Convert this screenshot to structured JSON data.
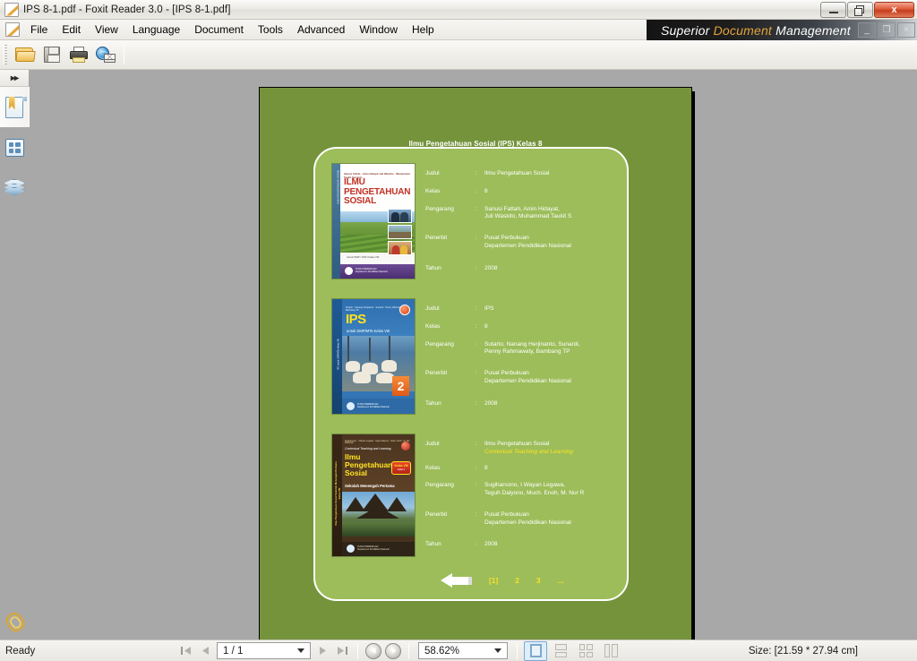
{
  "window": {
    "title": "IPS 8-1.pdf - Foxit Reader 3.0 - [IPS 8-1.pdf]",
    "title_icon": "pdf-document-icon",
    "minimize_label": "",
    "maximize_label": "",
    "close_label": "x"
  },
  "menu": {
    "icon": "pdf-document-icon",
    "items": [
      {
        "label": "File"
      },
      {
        "label": "Edit"
      },
      {
        "label": "View"
      },
      {
        "label": "Language"
      },
      {
        "label": "Document"
      },
      {
        "label": "Tools"
      },
      {
        "label": "Advanced"
      },
      {
        "label": "Window"
      },
      {
        "label": "Help"
      }
    ],
    "banner": {
      "word1": "Superior ",
      "word2": "Document ",
      "word3": "Management",
      "min_label": "_",
      "restore_label": "❐",
      "close_label": "×"
    }
  },
  "toolbar": {
    "buttons": [
      {
        "name": "open-file-button",
        "icon": "open-folder-icon",
        "tooltip": "Open"
      },
      {
        "name": "save-button",
        "icon": "floppy-disk-icon",
        "tooltip": "Save"
      },
      {
        "name": "print-button",
        "icon": "printer-icon",
        "tooltip": "Print"
      },
      {
        "name": "email-button",
        "icon": "globe-envelope-icon",
        "tooltip": "Email"
      }
    ]
  },
  "sidebar": {
    "expand_label": "▸▸",
    "items": [
      {
        "name": "sidebar-item-bookmarks",
        "icon": "bookmark-icon",
        "active": true
      },
      {
        "name": "sidebar-item-pages",
        "icon": "page-thumbnails-icon",
        "active": false
      },
      {
        "name": "sidebar-item-layers",
        "icon": "layers-icon",
        "active": false
      }
    ],
    "bottom_item": {
      "name": "sidebar-item-attachments",
      "icon": "paperclip-icon"
    }
  },
  "document": {
    "page_header": "Ilmu Pengetahuan Sosial (IPS) Kelas 8",
    "page_bg_color": "#74933b",
    "panel_bg_color": "#9cbd5a",
    "accent_color": "#ffe21f",
    "labels": {
      "judul": "Judul",
      "kelas": "Kelas",
      "pengarang": "Pengarang",
      "penerbit": "Penerbit",
      "tahun": "Tahun",
      "colon": ":"
    },
    "entries": [
      {
        "cover": {
          "style": "book-1",
          "spine_text": "ILMU PENGETAHUAN SOSIAL",
          "authors_line": "Sanusi Fattah · Amin Hidayat\nJuli Waskito · Muhammad Taukit Setyanto",
          "title_lines": "ILMU\nPENGETAHUAN\nSOSIAL",
          "subtitle": "untuk SMP / MTs Kelas VIII",
          "footer": "PUSAT PERBUKUAN\nDepartemen Pendidikan Nasional"
        },
        "judul": "Ilmu Pengetahuan Sosial",
        "judul_sub": "",
        "kelas": "8",
        "pengarang": "Sanusi Fattah, Amin Hidayat,\nJuli Waskito, Muhammad Taukit S",
        "penerbit": "Pusat Perbukuan\nDepartemen Pendidikan Nasional",
        "tahun": "2008"
      },
      {
        "cover": {
          "style": "book-2",
          "spine_text": "IPS untuk SMP/MTs Kelas VIII",
          "authors_line": "Sutarto · Nanang Herjinanto · Sunardi · Penny Rahmawaty · Bambang TP",
          "title_lines": "IPS",
          "subtitle": "untuk SMP/MTs Kelas VIII",
          "volume_badge": "2",
          "footer": "PUSAT PERBUKUAN\nDepartemen Pendidikan Nasional"
        },
        "judul": "IPS",
        "judul_sub": "",
        "kelas": "8",
        "pengarang": "Sutarto, Nanang Herjinanto, Sunardi,\nPenny Rahmawaty, Bambang TP",
        "penerbit": "Pusat Perbukuan\nDepartemen Pendidikan Nasional",
        "tahun": "2008"
      },
      {
        "cover": {
          "style": "book-3",
          "spine_text": "Ilmu Pengetahuan Sosial  Sekolah Menengah Pertama  Kelas VIII",
          "authors_line": "Sugiharsono · I Wayan Legawa · Teguh Dalyono · Much. Enoh · M. Nur Rokhman",
          "ctl_line": "Contextual Teaching and Learning",
          "title_lines": "Ilmu\nPengetahuan\nSosial",
          "subtitle": "Sekolah Menengah Pertama",
          "badge_line1": "Kelas VIII",
          "badge_line2": "Edisi 4",
          "footer": "PUSAT PERBUKUAN\nDepartemen Pendidikan Nasional"
        },
        "judul": "Ilmu Pengetahuan Sosial",
        "judul_sub": "Contextual Teaching and Learning",
        "kelas": "8",
        "pengarang": "Sugiharsono, I Wayan Legawa,\nTeguh Dalyono, Much. Enoh, M. Nur R",
        "penerbit": "Pusat Perbukuan\nDepartemen Pendidikan Nasional",
        "tahun": "2008"
      }
    ],
    "pagination": {
      "back_arrow_icon": "left-arrow-icon",
      "pages": [
        "[1]",
        "2",
        "3",
        "..."
      ]
    }
  },
  "statusbar": {
    "status": "Ready",
    "first_page_icon": "first-page-icon",
    "prev_page_icon": "previous-page-icon",
    "page_value": "1 / 1",
    "next_page_icon": "next-page-icon",
    "last_page_icon": "last-page-icon",
    "prev_view_icon": "previous-view-icon",
    "next_view_icon": "next-view-icon",
    "zoom_value": "58.62%",
    "layout_buttons": [
      {
        "name": "layout-single-page",
        "icon": "single-page-icon",
        "active": true
      },
      {
        "name": "layout-continuous",
        "icon": "continuous-page-icon",
        "active": false
      },
      {
        "name": "layout-facing",
        "icon": "facing-pages-icon",
        "active": false
      },
      {
        "name": "layout-continuous-facing",
        "icon": "continuous-facing-icon",
        "active": false
      }
    ],
    "size_text": "Size: [21.59 * 27.94 cm]"
  }
}
